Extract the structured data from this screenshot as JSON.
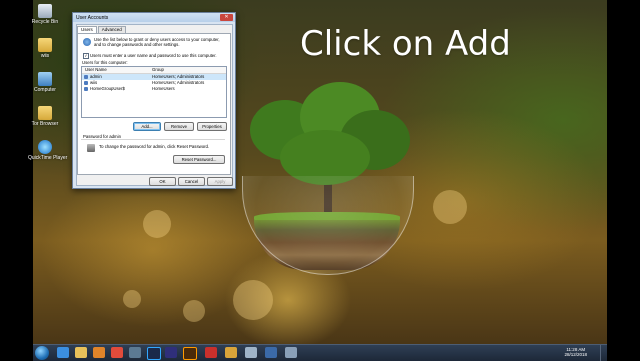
{
  "heading": "Click on Add",
  "desktop_icons": [
    {
      "label": "Recycle Bin",
      "icon": "recycle-bin-icon"
    },
    {
      "label": "wiis",
      "icon": "folder-icon"
    },
    {
      "label": "Computer",
      "icon": "computer-icon"
    },
    {
      "label": "Tor Browser",
      "icon": "folder-icon"
    },
    {
      "label": "QuickTime Player",
      "icon": "quicktime-icon"
    }
  ],
  "dialog": {
    "title": "User Accounts",
    "close": "✕",
    "tabs": [
      "Users",
      "Advanced"
    ],
    "description": "Use the list below to grant or deny users access to your computer, and to change passwords and other settings.",
    "must_enter_label": "Users must enter a user name and password to use this computer.",
    "must_enter_checked": "✓",
    "users_label": "Users for this computer:",
    "columns": [
      "User Name",
      "Group"
    ],
    "users": [
      {
        "name": "admin",
        "group": "HomeUsers; Administrators"
      },
      {
        "name": "wiis",
        "group": "HomeUsers; Administrators"
      },
      {
        "name": "HomeGroupUser$",
        "group": "HomeUsers"
      }
    ],
    "buttons": {
      "add": "Add...",
      "remove": "Remove",
      "properties": "Properties"
    },
    "password_section": "Password for admin",
    "password_text": "To change the password for admin, click Reset Password.",
    "reset_password": "Reset Password...",
    "ok": "OK",
    "cancel": "Cancel",
    "apply": "Apply"
  },
  "taskbar": {
    "time": "11:28 AM",
    "date": "28/12/2018"
  }
}
